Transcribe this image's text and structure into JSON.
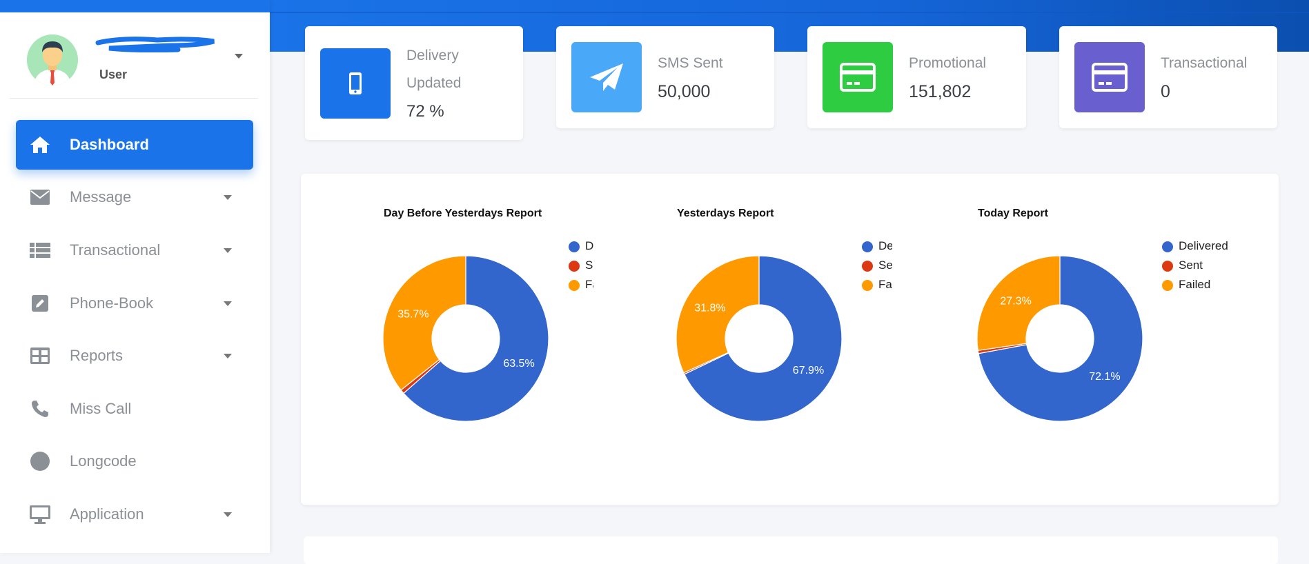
{
  "user": {
    "name": "User"
  },
  "sidebar": {
    "items": [
      {
        "label": "Dashboard",
        "icon": "home-icon",
        "active": true,
        "has_submenu": false
      },
      {
        "label": "Message",
        "icon": "envelope-icon",
        "active": false,
        "has_submenu": true
      },
      {
        "label": "Transactional",
        "icon": "list-icon",
        "active": false,
        "has_submenu": true
      },
      {
        "label": "Phone-Book",
        "icon": "edit-icon",
        "active": false,
        "has_submenu": true
      },
      {
        "label": "Reports",
        "icon": "table-icon",
        "active": false,
        "has_submenu": true
      },
      {
        "label": "Miss Call",
        "icon": "phone-icon",
        "active": false,
        "has_submenu": false
      },
      {
        "label": "Longcode",
        "icon": "circle-icon",
        "active": false,
        "has_submenu": false
      },
      {
        "label": "Application",
        "icon": "monitor-icon",
        "active": false,
        "has_submenu": true
      }
    ]
  },
  "stats": [
    {
      "title_line1": "Delivery",
      "title_line2": "Updated",
      "value": "72 %",
      "icon": "mobile-icon",
      "color": "#1a73e8"
    },
    {
      "title_line1": "SMS Sent",
      "value": "50,000",
      "icon": "paper-plane-icon",
      "color": "#4aa8f8"
    },
    {
      "title_line1": "Promotional",
      "value": "151,802",
      "icon": "credit-card-icon",
      "color": "#2ecc40"
    },
    {
      "title_line1": "Transactional",
      "value": "0",
      "icon": "credit-card-icon",
      "color": "#6a5fcf"
    }
  ],
  "colors": {
    "delivered": "#3366cc",
    "sent": "#dc3912",
    "failed": "#ff9900",
    "primary": "#1a73e8"
  },
  "chart_data": [
    {
      "type": "pie",
      "title": "Day Before Yesterdays Report",
      "legend_visible": [
        "De",
        "Se",
        "Fa"
      ],
      "slices": [
        {
          "name": "Delivered",
          "value": 63.5,
          "label": "63.5%"
        },
        {
          "name": "Sent",
          "value": 0.8,
          "label": ""
        },
        {
          "name": "Failed",
          "value": 35.7,
          "label": "35.7%"
        }
      ]
    },
    {
      "type": "pie",
      "title": "Yesterdays Report",
      "legend_visible": [
        "Del",
        "Ser",
        "Fai"
      ],
      "slices": [
        {
          "name": "Delivered",
          "value": 67.9,
          "label": "67.9%"
        },
        {
          "name": "Sent",
          "value": 0.3,
          "label": ""
        },
        {
          "name": "Failed",
          "value": 31.8,
          "label": "31.8%"
        }
      ]
    },
    {
      "type": "pie",
      "title": "Today Report",
      "legend_visible": [
        "Delivered",
        "Sent",
        "Failed"
      ],
      "slices": [
        {
          "name": "Delivered",
          "value": 72.1,
          "label": "72.1%"
        },
        {
          "name": "Sent",
          "value": 0.6,
          "label": ""
        },
        {
          "name": "Failed",
          "value": 27.3,
          "label": "27.3%"
        }
      ]
    }
  ]
}
